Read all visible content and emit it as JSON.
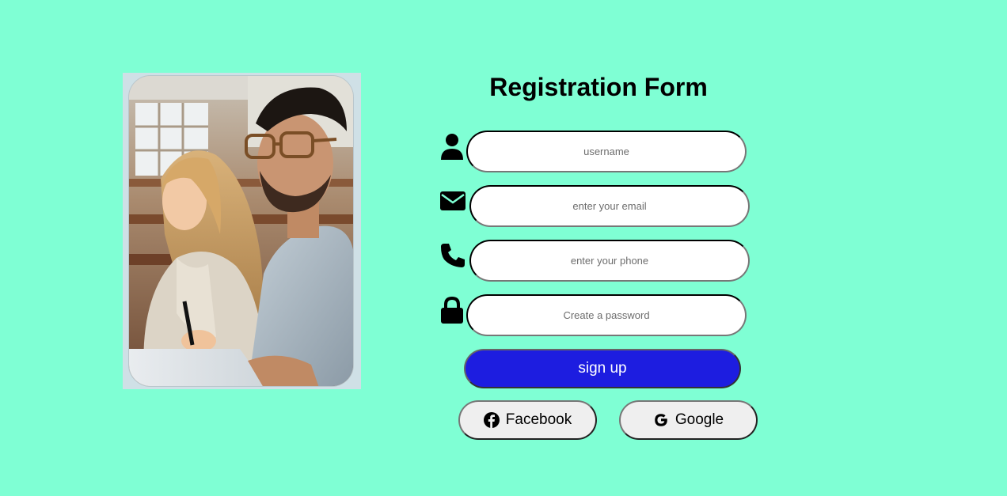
{
  "page": {
    "background": "#7fffd4",
    "accent": "#1d1de0"
  },
  "hero_image": {
    "icon": "students-photo"
  },
  "form": {
    "title": "Registration Form",
    "fields": [
      {
        "icon": "user-icon",
        "placeholder": "username",
        "type": "text"
      },
      {
        "icon": "envelope-icon",
        "placeholder": "enter your email",
        "type": "email"
      },
      {
        "icon": "phone-icon",
        "placeholder": "enter your phone",
        "type": "tel"
      },
      {
        "icon": "lock-icon",
        "placeholder": "Create a password",
        "type": "password"
      }
    ],
    "submit_label": "sign up"
  },
  "social": {
    "facebook": {
      "label": "Facebook",
      "icon": "facebook-icon"
    },
    "google": {
      "label": "Google",
      "icon": "google-icon"
    }
  }
}
